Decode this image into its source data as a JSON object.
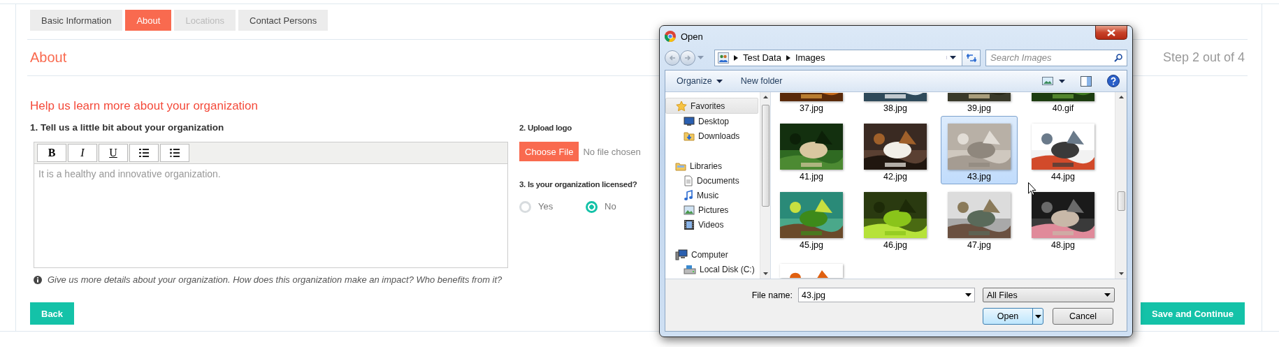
{
  "tabs": [
    {
      "label": "Basic Information",
      "selected": false,
      "disabled": false
    },
    {
      "label": "About",
      "selected": true,
      "disabled": false
    },
    {
      "label": "Locations",
      "selected": false,
      "disabled": true
    },
    {
      "label": "Contact Persons",
      "selected": false,
      "disabled": false
    }
  ],
  "section": {
    "title": "About",
    "step": "Step 2 out of 4"
  },
  "form": {
    "heading": "Help us learn more about your organization",
    "description": {
      "label": "1. Tell us a little bit about your organization",
      "toolbar": [
        {
          "kind": "bold",
          "label": "B"
        },
        {
          "kind": "italic",
          "label": "I"
        },
        {
          "kind": "underline",
          "label": "U"
        },
        {
          "kind": "ordered-list"
        },
        {
          "kind": "bullet-list"
        }
      ],
      "value": "It is a healthy and innovative organization.",
      "hint": "Give us more details about your organization. How does this organization make an impact? Who benefits from it?"
    },
    "logo": {
      "label": "2. Upload logo",
      "button": "Choose File",
      "status": "No file chosen"
    },
    "licensed": {
      "label": "3. Is your organization licensed?",
      "options": [
        {
          "label": "Yes",
          "selected": false
        },
        {
          "label": "No",
          "selected": true
        }
      ]
    }
  },
  "buttons": {
    "back": "Back",
    "save": "Save and Continue"
  },
  "dialog": {
    "title": "Open",
    "breadcrumb": [
      "Test Data",
      "Images"
    ],
    "search": {
      "placeholder": "Search Images"
    },
    "toolbar": {
      "organize": "Organize",
      "new_folder": "New folder"
    },
    "sidebar": [
      {
        "label": "Favorites",
        "kind": "group",
        "selected": true
      },
      {
        "label": "Desktop",
        "kind": "item",
        "selected": false
      },
      {
        "label": "Downloads",
        "kind": "item",
        "selected": false
      },
      {
        "label": "Libraries",
        "kind": "group",
        "selected": false
      },
      {
        "label": "Documents",
        "kind": "item",
        "selected": false
      },
      {
        "label": "Music",
        "kind": "item",
        "selected": false
      },
      {
        "label": "Pictures",
        "kind": "item",
        "selected": false
      },
      {
        "label": "Videos",
        "kind": "item",
        "selected": false
      },
      {
        "label": "Computer",
        "kind": "group",
        "selected": false
      },
      {
        "label": "Local Disk (C:)",
        "kind": "item",
        "selected": false
      }
    ],
    "files": [
      {
        "name": "37.jpg",
        "selected": false
      },
      {
        "name": "38.jpg",
        "selected": false
      },
      {
        "name": "39.jpg",
        "selected": false
      },
      {
        "name": "40.gif",
        "selected": false
      },
      {
        "name": "41.jpg",
        "selected": false
      },
      {
        "name": "42.jpg",
        "selected": false
      },
      {
        "name": "43.jpg",
        "selected": true
      },
      {
        "name": "44.jpg",
        "selected": false
      },
      {
        "name": "45.jpg",
        "selected": false
      },
      {
        "name": "46.jpg",
        "selected": false
      },
      {
        "name": "47.jpg",
        "selected": false
      },
      {
        "name": "48.jpg",
        "selected": false
      },
      {
        "selected": false
      }
    ],
    "file_name": {
      "label": "File name:",
      "value": "43.jpg"
    },
    "file_type": "All Files",
    "open": "Open",
    "cancel": "Cancel"
  }
}
